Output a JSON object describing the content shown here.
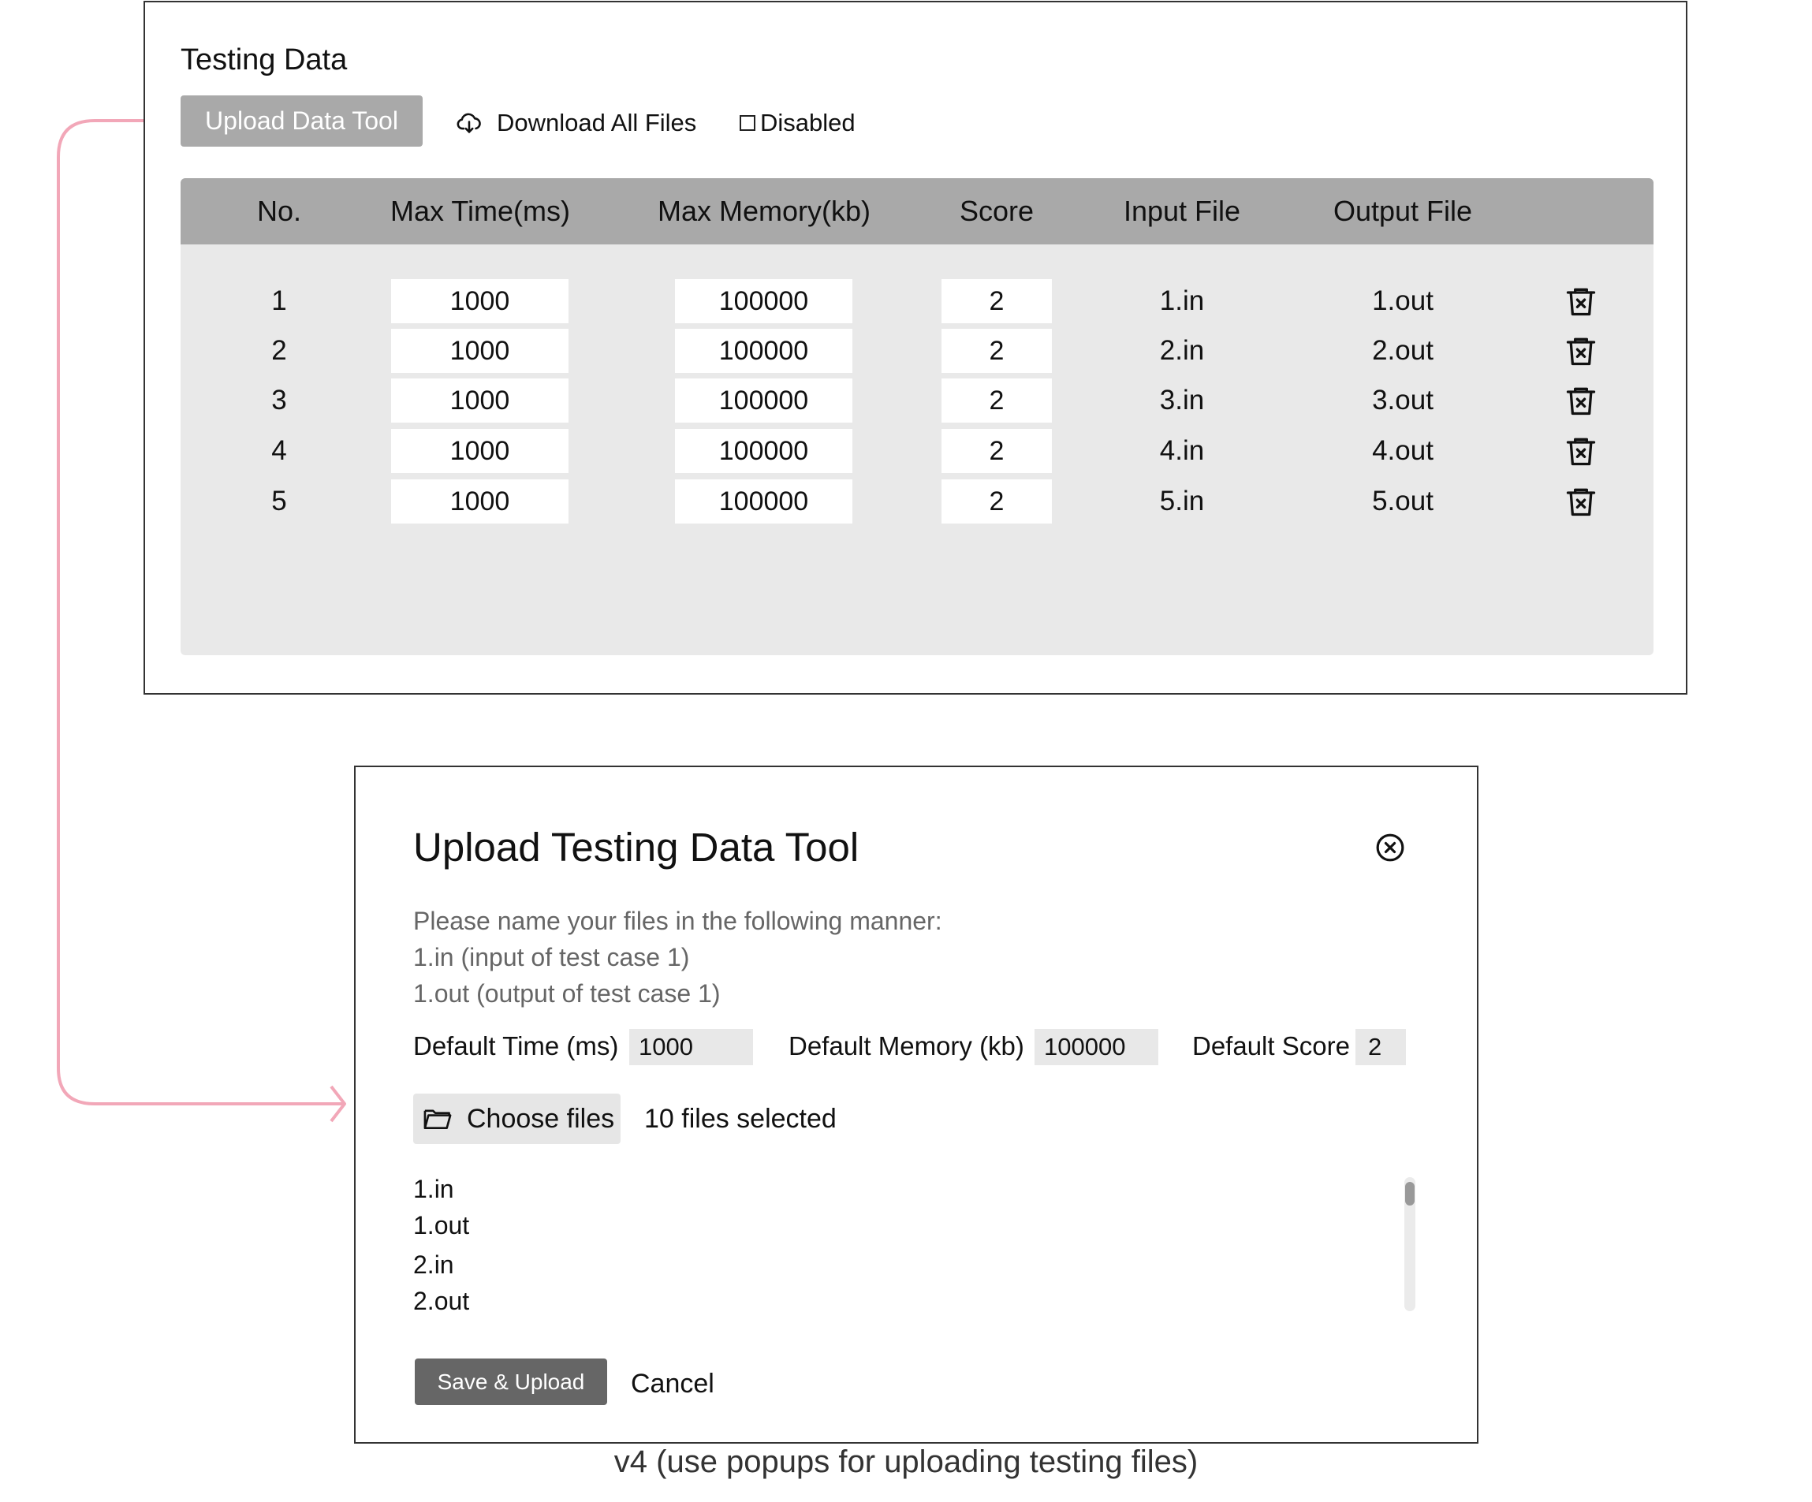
{
  "testing_data": {
    "title": "Testing Data",
    "upload_button": "Upload Data Tool",
    "download_all": "Download All Files",
    "disabled_label": "Disabled",
    "columns": [
      "No.",
      "Max Time(ms)",
      "Max Memory(kb)",
      "Score",
      "Input File",
      "Output File"
    ],
    "rows": [
      {
        "no": "1",
        "max_time": "1000",
        "max_memory": "100000",
        "score": "2",
        "input": "1.in",
        "output": "1.out"
      },
      {
        "no": "2",
        "max_time": "1000",
        "max_memory": "100000",
        "score": "2",
        "input": "2.in",
        "output": "2.out"
      },
      {
        "no": "3",
        "max_time": "1000",
        "max_memory": "100000",
        "score": "2",
        "input": "3.in",
        "output": "3.out"
      },
      {
        "no": "4",
        "max_time": "1000",
        "max_memory": "100000",
        "score": "2",
        "input": "4.in",
        "output": "4.out"
      },
      {
        "no": "5",
        "max_time": "1000",
        "max_memory": "100000",
        "score": "2",
        "input": "5.in",
        "output": "5.out"
      }
    ],
    "icons": {
      "download": "cloud-download-icon",
      "delete": "trash-icon"
    }
  },
  "dialog": {
    "title": "Upload Testing Data Tool",
    "instructions": [
      "Please name your files in the following manner:",
      "1.in (input of test case 1)",
      "1.out  (output of test case 1)"
    ],
    "default_time_label": "Default Time (ms)",
    "default_time_value": "1000",
    "default_memory_label": "Default Memory (kb)",
    "default_memory_value": "100000",
    "default_score_label": "Default Score",
    "default_score_value": "2",
    "choose_files_label": "Choose files",
    "files_selected": "10 files selected",
    "file_list": [
      "1.in",
      "1.out",
      "2.in",
      "2.out"
    ],
    "save_button": "Save & Upload",
    "cancel_button": "Cancel",
    "icons": {
      "close": "close-circle-icon",
      "folder": "folder-icon"
    }
  },
  "caption": "v4 (use popups for uploading testing files)",
  "colors": {
    "connector": "#f2a7b8",
    "header_gray": "#a9a9a9",
    "table_bg": "#e9e9e9",
    "primary_dark": "#666666"
  }
}
